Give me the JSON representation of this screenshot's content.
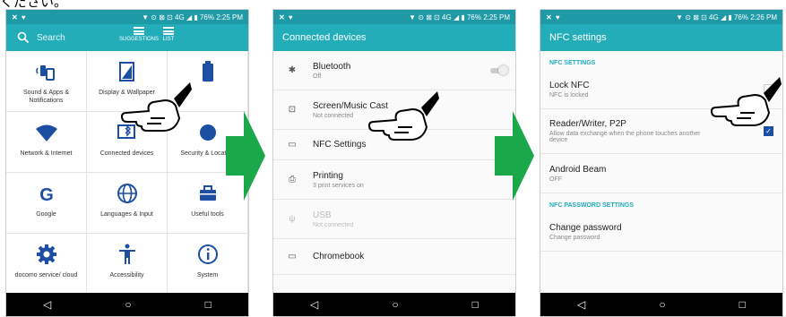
{
  "caption": "ください。",
  "status": {
    "icons": "✕ ♥",
    "right1": "▼ ⊙ ⊠ ⊡ 4G ◢ ▮",
    "pct": "76%",
    "time1": "2:25 PM",
    "time3": "2:26 PM"
  },
  "nav": {
    "back": "◁",
    "home": "○",
    "recent": "□"
  },
  "s1": {
    "search": "Search",
    "suggestions": "SUGGESTIONS",
    "list": "LIST",
    "tiles": [
      {
        "label": "Sound & Apps & Notifications",
        "icon": "sound-icon"
      },
      {
        "label": "Display & Wallpaper",
        "icon": "display-icon"
      },
      {
        "label": "",
        "icon": "battery-icon"
      },
      {
        "label": "Network & Internet",
        "icon": "wifi-icon"
      },
      {
        "label": "Connected devices",
        "icon": "connected-devices-icon"
      },
      {
        "label": "Security & Location",
        "icon": "security-icon"
      },
      {
        "label": "Google",
        "icon": "google-icon"
      },
      {
        "label": "Languages & Input",
        "icon": "globe-icon"
      },
      {
        "label": "Useful tools",
        "icon": "toolbox-icon"
      },
      {
        "label": "docomo service/ cloud",
        "icon": "gear-icon"
      },
      {
        "label": "Accessibility",
        "icon": "accessibility-icon"
      },
      {
        "label": "System",
        "icon": "info-icon"
      }
    ]
  },
  "s2": {
    "title": "Connected devices",
    "rows": [
      {
        "title": "Bluetooth",
        "sub": "Off",
        "icon": "✱"
      },
      {
        "title": "Screen/Music Cast",
        "sub": "Not connected",
        "icon": "⊡"
      },
      {
        "title": "NFC Settings",
        "sub": "",
        "icon": "▭"
      },
      {
        "title": "Printing",
        "sub": "3 print services on",
        "icon": "⎙"
      },
      {
        "title": "USB",
        "sub": "Not connected",
        "icon": "ψ"
      },
      {
        "title": "Chromebook",
        "sub": "",
        "icon": "▭"
      }
    ]
  },
  "s3": {
    "title": "NFC settings",
    "sec1": "NFC SETTINGS",
    "sec2": "NFC PASSWORD SETTINGS",
    "rows": [
      {
        "title": "Lock NFC",
        "sub": "NFC is locked"
      },
      {
        "title": "Reader/Writer, P2P",
        "sub": "Allow data exchange when the phone touches another device"
      },
      {
        "title": "Android Beam",
        "sub": "OFF"
      },
      {
        "title": "Change password",
        "sub": "Change password"
      }
    ],
    "check": "✓"
  },
  "colors": {
    "teal": "#22adb9",
    "arrow": "#1aa84a"
  }
}
